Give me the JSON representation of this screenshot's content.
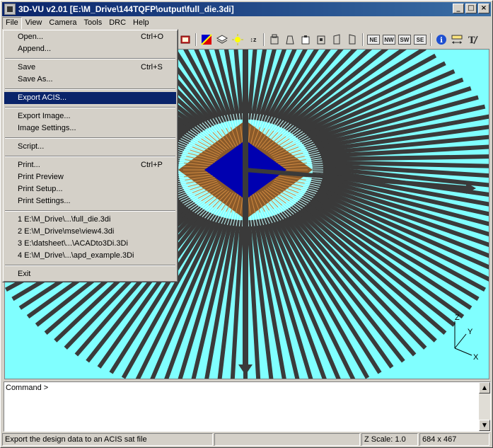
{
  "window": {
    "title": "3D-VU v2.01 [E:\\M_Drive\\144TQFP\\output\\full_die.3di]",
    "minimize": "_",
    "maximize": "□",
    "close": "×"
  },
  "menubar": {
    "items": [
      "File",
      "View",
      "Camera",
      "Tools",
      "DRC",
      "Help"
    ]
  },
  "file_menu": {
    "open": "Open...",
    "open_shortcut": "Ctrl+O",
    "append": "Append...",
    "save": "Save",
    "save_shortcut": "Ctrl+S",
    "save_as": "Save As...",
    "export_acis": "Export ACIS...",
    "export_image": "Export Image...",
    "image_settings": "Image Settings...",
    "script": "Script...",
    "print": "Print...",
    "print_shortcut": "Ctrl+P",
    "print_preview": "Print Preview",
    "print_setup": "Print Setup...",
    "print_settings": "Print Settings...",
    "recent1": "1 E:\\M_Drive\\...\\full_die.3di",
    "recent2": "2 E:\\M_Drive\\mse\\view4.3di",
    "recent3": "3 E:\\datsheet\\...\\ACADto3Di.3Di",
    "recent4": "4 E:\\M_Drive\\...\\apd_example.3Di",
    "exit": "Exit"
  },
  "toolbar": {
    "ne": "NE",
    "nw": "NW",
    "sw": "SW",
    "se": "SE",
    "info": "i",
    "zlabel": "↕z"
  },
  "viewport": {
    "background": "#80ffff",
    "axis_z": "Z",
    "axis_y": "Y",
    "axis_x": "X"
  },
  "command": {
    "prompt": "Command >"
  },
  "statusbar": {
    "message": "Export the design data to an ACIS sat file",
    "zscale": "Z Scale: 1.0",
    "size": "684 x 467"
  }
}
